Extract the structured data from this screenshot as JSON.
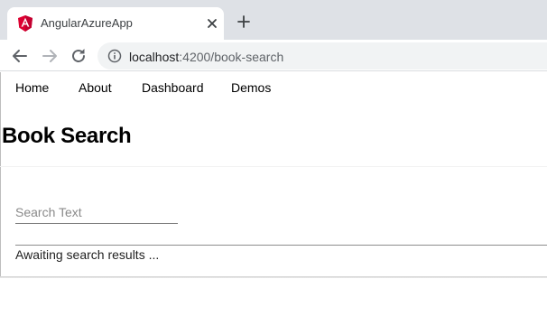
{
  "browser": {
    "tab_title": "AngularAzureApp",
    "tab_close_glyph": "✕",
    "address": {
      "host": "localhost",
      "path": ":4200/book-search"
    },
    "icons": [
      "angular-logo-icon",
      "close-icon",
      "plus-icon",
      "back-arrow-icon",
      "forward-arrow-icon",
      "reload-icon",
      "info-icon"
    ],
    "colors": {
      "tabstrip": "#dee1e6",
      "angular_red": "#dd0031",
      "omnibox": "#f1f3f4"
    }
  },
  "app": {
    "nav": {
      "home": "Home",
      "about": "About",
      "dashboard": "Dashboard",
      "demos": "Demos"
    },
    "title": "Book Search",
    "search": {
      "placeholder": "Search Text",
      "value": ""
    },
    "status": "Awaiting search results ..."
  }
}
